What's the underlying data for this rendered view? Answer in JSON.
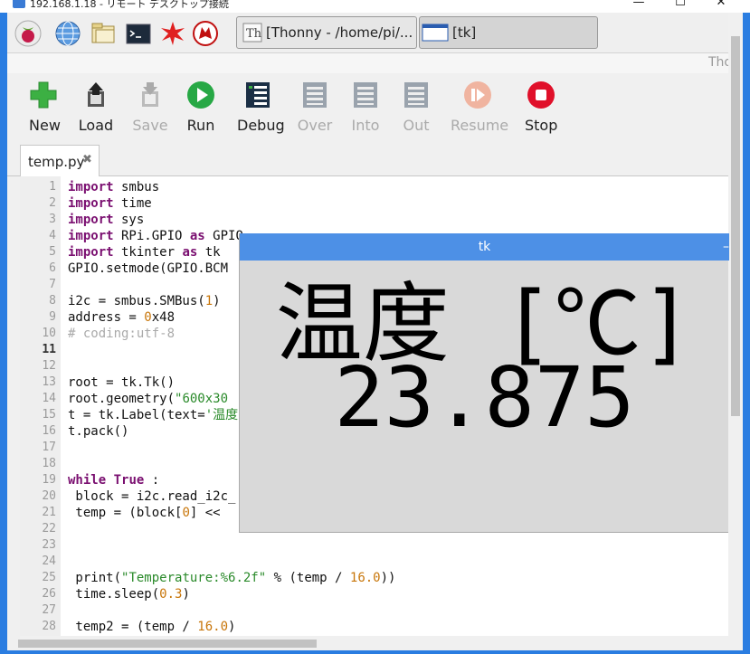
{
  "rdp_window": {
    "title": "192.168.1.18 - リモート デスクトップ接続",
    "minimize": "—",
    "maximize": "☐",
    "close": "✕"
  },
  "taskbar": {
    "tasks": [
      {
        "label": "[Thonny  -  /home/pi/..."
      },
      {
        "label": "[tk]"
      }
    ]
  },
  "thonny": {
    "title_fragment": "Tho",
    "toolbar": [
      {
        "label": "New",
        "icon": "plus-icon",
        "enabled": true
      },
      {
        "label": "Load",
        "icon": "load-icon",
        "enabled": true
      },
      {
        "label": "Save",
        "icon": "save-icon",
        "enabled": false
      },
      {
        "label": "Run",
        "icon": "run-icon",
        "enabled": true
      },
      {
        "label": "Debug",
        "icon": "debug-icon",
        "enabled": true
      },
      {
        "label": "Over",
        "icon": "step-over-icon",
        "enabled": false
      },
      {
        "label": "Into",
        "icon": "step-into-icon",
        "enabled": false
      },
      {
        "label": "Out",
        "icon": "step-out-icon",
        "enabled": false
      },
      {
        "label": "Resume",
        "icon": "resume-icon",
        "enabled": false
      },
      {
        "label": "Stop",
        "icon": "stop-icon",
        "enabled": true
      }
    ],
    "tab": {
      "label": "temp.py",
      "close": "✖"
    },
    "line_numbers": [
      "1",
      "2",
      "3",
      "4",
      "5",
      "6",
      "7",
      "8",
      "9",
      "10",
      "11",
      "12",
      "13",
      "14",
      "15",
      "16",
      "17",
      "18",
      "19",
      "20",
      "21",
      "22",
      "23",
      "24",
      "25",
      "26",
      "27",
      "28"
    ],
    "code": [
      "import smbus",
      "import time",
      "import sys",
      "import RPi.GPIO as GPIO",
      "import tkinter as tk",
      "GPIO.setmode(GPIO.BCM",
      "",
      "i2c = smbus.SMBus(1)",
      "address = 0x48",
      "# coding:utf-8",
      "",
      "",
      "root = tk.Tk()",
      "root.geometry(\"600x30",
      "t = tk.Label(text='温度",
      "t.pack()",
      "",
      "",
      "while True :",
      " block = i2c.read_i2c_",
      " temp = (block[0] <<",
      "",
      "",
      "",
      " print(\"Temperature:%6.2f\" % (temp / 16.0))",
      " time.sleep(0.3)",
      "",
      " temp2 = (temp / 16.0)"
    ]
  },
  "tk_window": {
    "title": "tk",
    "line1": "温度 [℃]",
    "line2": "23.875"
  },
  "colors": {
    "accent": "#2a7de1",
    "tk_title": "#4d90e6",
    "keyword": "#7a0f70",
    "number": "#c8760a",
    "string": "#2a8a2a",
    "comment": "#aaaaaa"
  }
}
